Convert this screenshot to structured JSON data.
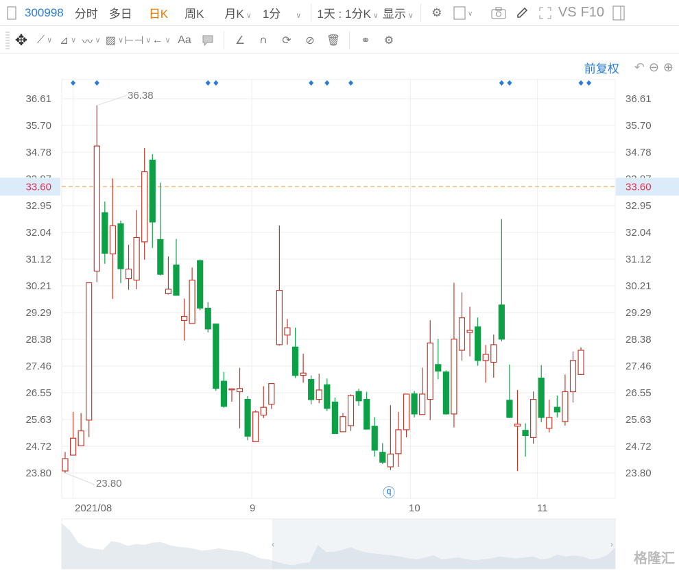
{
  "toolbar": {
    "code": "300998",
    "tabs": [
      "分时",
      "多日",
      "日K",
      "周K",
      "月K",
      "1分"
    ],
    "active_tab": "日K",
    "period": "1天 : 1分K",
    "display": "显示",
    "vs": "VS",
    "f10": "F10"
  },
  "toolbar2": {
    "text_tool": "Aa"
  },
  "adjust": {
    "label": "前复权"
  },
  "colors": {
    "up": "#c0392b",
    "down": "#0ea046",
    "accent": "#2a7bd5",
    "active": "#f07800",
    "price_line": "#f0a040"
  },
  "chart_data": {
    "type": "candlestick",
    "title": "300998 日K",
    "y_ticks": [
      "36.61",
      "35.70",
      "34.78",
      "33.87",
      "32.95",
      "32.04",
      "31.12",
      "30.21",
      "29.29",
      "28.38",
      "27.46",
      "26.55",
      "25.63",
      "24.72",
      "23.80"
    ],
    "ylim": [
      23.8,
      36.61
    ],
    "x_labels": [
      {
        "label": "2021/08",
        "index": 1
      },
      {
        "label": "9",
        "index": 23
      },
      {
        "label": "10",
        "index": 43
      },
      {
        "label": "11",
        "index": 59
      }
    ],
    "current_price": "33.60",
    "max_label": "36.38",
    "min_label": "23.80",
    "event_marker_indices": [
      1,
      4,
      18,
      19,
      31,
      33,
      36,
      55,
      56,
      65,
      66
    ],
    "ohlc": [
      [
        23.87,
        24.52,
        23.8,
        24.29
      ],
      [
        24.41,
        25.89,
        24.41,
        24.99
      ],
      [
        24.73,
        25.85,
        24.71,
        25.24
      ],
      [
        25.61,
        30.31,
        25.03,
        30.31
      ],
      [
        30.71,
        36.38,
        30.33,
        34.99
      ],
      [
        32.71,
        33.09,
        30.96,
        31.32
      ],
      [
        31.3,
        33.88,
        29.76,
        32.26
      ],
      [
        32.33,
        32.44,
        30.3,
        30.79
      ],
      [
        30.45,
        31.61,
        30.07,
        30.78
      ],
      [
        30.4,
        32.8,
        30.09,
        31.86
      ],
      [
        31.71,
        34.92,
        31.1,
        34.11
      ],
      [
        34.51,
        34.71,
        31.5,
        32.39
      ],
      [
        31.79,
        33.74,
        30.56,
        30.6
      ],
      [
        29.94,
        31.21,
        29.91,
        30.09
      ],
      [
        30.92,
        31.81,
        29.88,
        29.88
      ],
      [
        29.02,
        29.77,
        28.33,
        29.16
      ],
      [
        28.92,
        30.83,
        28.92,
        30.4
      ],
      [
        31.07,
        31.11,
        29.37,
        29.44
      ],
      [
        29.44,
        29.65,
        28.61,
        28.73
      ],
      [
        28.9,
        28.9,
        26.61,
        26.7
      ],
      [
        26.94,
        27.26,
        26.03,
        26.08
      ],
      [
        26.66,
        26.7,
        26.24,
        26.68
      ],
      [
        26.58,
        27.4,
        25.33,
        26.69
      ],
      [
        26.32,
        26.43,
        24.92,
        25.06
      ],
      [
        24.87,
        25.94,
        24.87,
        25.89
      ],
      [
        25.78,
        26.77,
        25.68,
        26.05
      ],
      [
        26.15,
        26.86,
        25.99,
        26.86
      ],
      [
        28.19,
        32.27,
        28.16,
        30.05
      ],
      [
        28.52,
        29.07,
        28.19,
        28.77
      ],
      [
        28.11,
        28.77,
        27.05,
        27.14
      ],
      [
        27.14,
        27.88,
        26.89,
        27.22
      ],
      [
        27.0,
        27.14,
        26.15,
        26.31
      ],
      [
        26.32,
        27.2,
        26.19,
        26.64
      ],
      [
        26.82,
        27.03,
        25.92,
        26.01
      ],
      [
        26.23,
        26.38,
        25.15,
        25.15
      ],
      [
        25.21,
        25.85,
        25.21,
        25.73
      ],
      [
        25.42,
        26.49,
        25.24,
        26.45
      ],
      [
        26.59,
        26.68,
        26.1,
        26.27
      ],
      [
        26.32,
        26.58,
        25.3,
        25.3
      ],
      [
        25.4,
        25.71,
        24.36,
        24.58
      ],
      [
        24.51,
        24.82,
        24.11,
        24.17
      ],
      [
        24.01,
        26.12,
        23.9,
        24.45
      ],
      [
        24.46,
        25.89,
        24.01,
        25.28
      ],
      [
        25.28,
        26.5,
        25.02,
        26.5
      ],
      [
        26.51,
        26.61,
        25.7,
        25.82
      ],
      [
        25.8,
        27.4,
        25.8,
        26.5
      ],
      [
        26.32,
        29.03,
        25.61,
        28.25
      ],
      [
        27.51,
        28.39,
        27.01,
        27.29
      ],
      [
        27.26,
        27.31,
        25.8,
        25.82
      ],
      [
        25.82,
        30.31,
        25.36,
        28.38
      ],
      [
        28.0,
        29.98,
        27.65,
        29.11
      ],
      [
        28.61,
        29.49,
        27.79,
        28.68
      ],
      [
        28.8,
        29.12,
        27.47,
        27.65
      ],
      [
        27.65,
        28.18,
        26.89,
        27.86
      ],
      [
        27.59,
        28.54,
        27.06,
        28.19
      ],
      [
        29.55,
        32.49,
        28.31,
        28.38
      ],
      [
        26.29,
        27.51,
        25.68,
        25.7
      ],
      [
        25.4,
        26.64,
        23.87,
        25.47
      ],
      [
        25.26,
        25.5,
        24.36,
        25.08
      ],
      [
        25.01,
        26.59,
        24.8,
        26.32
      ],
      [
        27.05,
        27.49,
        25.54,
        25.7
      ],
      [
        25.33,
        26.31,
        25.19,
        25.7
      ],
      [
        26.05,
        26.45,
        25.7,
        25.89
      ],
      [
        25.56,
        27.17,
        25.42,
        26.58
      ],
      [
        26.58,
        27.96,
        26.21,
        27.65
      ],
      [
        27.17,
        28.1,
        27.17,
        28.0
      ]
    ],
    "navigator_values": [
      95,
      80,
      55,
      45,
      42,
      40,
      58,
      55,
      48,
      52,
      50,
      55,
      56,
      50,
      46,
      45,
      42,
      38,
      40,
      43,
      40,
      38,
      36,
      30,
      22,
      20,
      15,
      10,
      8,
      12,
      14,
      50,
      35,
      36,
      40,
      45,
      38,
      34,
      32,
      30,
      28,
      26,
      22,
      20,
      24,
      28,
      20,
      22,
      24,
      20,
      18,
      20,
      22,
      26,
      24,
      22,
      24,
      26,
      20,
      22,
      30,
      26,
      28,
      26,
      20,
      22,
      28,
      45
    ]
  },
  "watermark": "格隆汇"
}
